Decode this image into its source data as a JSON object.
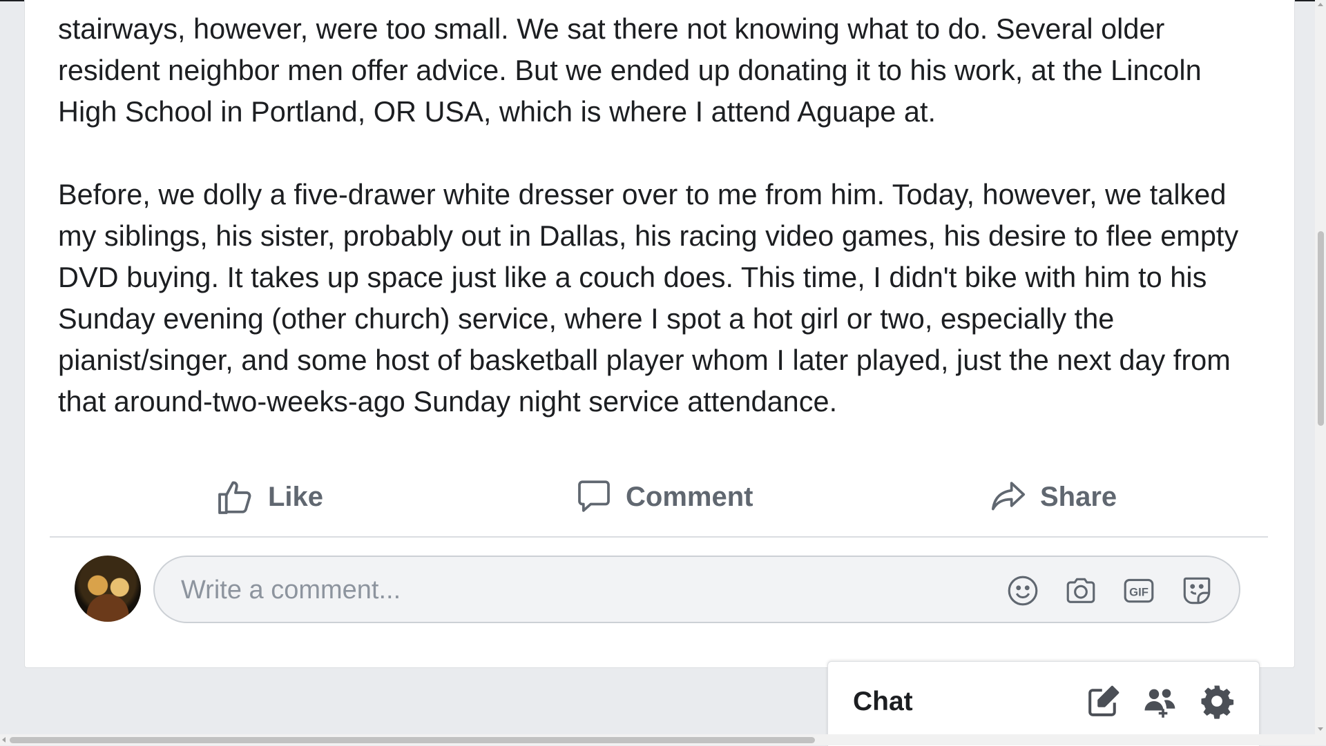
{
  "post": {
    "paragraphs": [
      "stairways, however, were too small. We sat there not knowing what to do. Several older resident neighbor men offer advice. But we ended up donating it to his work, at the Lincoln High School in Portland, OR USA, which is where I attend Aguape at.",
      "Before, we dolly a five-drawer white dresser over to me from him. Today, however, we talked my siblings, his sister, probably out in Dallas, his racing video games, his desire to flee empty DVD buying. It takes up space just like a couch does. This time, I didn't bike with him to his Sunday evening (other church) service, where I spot a hot girl or two, especially the pianist/singer, and some host of basketball player whom I later played, just the next day from that around-two-weeks-ago Sunday night service attendance."
    ]
  },
  "actions": {
    "like_label": "Like",
    "comment_label": "Comment",
    "share_label": "Share"
  },
  "comment_box": {
    "placeholder": "Write a comment...",
    "icons": [
      "emoji-icon",
      "camera-icon",
      "gif-icon",
      "sticker-icon"
    ]
  },
  "chat": {
    "title": "Chat",
    "icons": [
      "new-message-icon",
      "create-group-icon",
      "settings-gear-icon"
    ]
  },
  "colors": {
    "background": "#e9ebee",
    "card": "#ffffff",
    "action_text": "#606770",
    "placeholder": "#8d949e"
  }
}
